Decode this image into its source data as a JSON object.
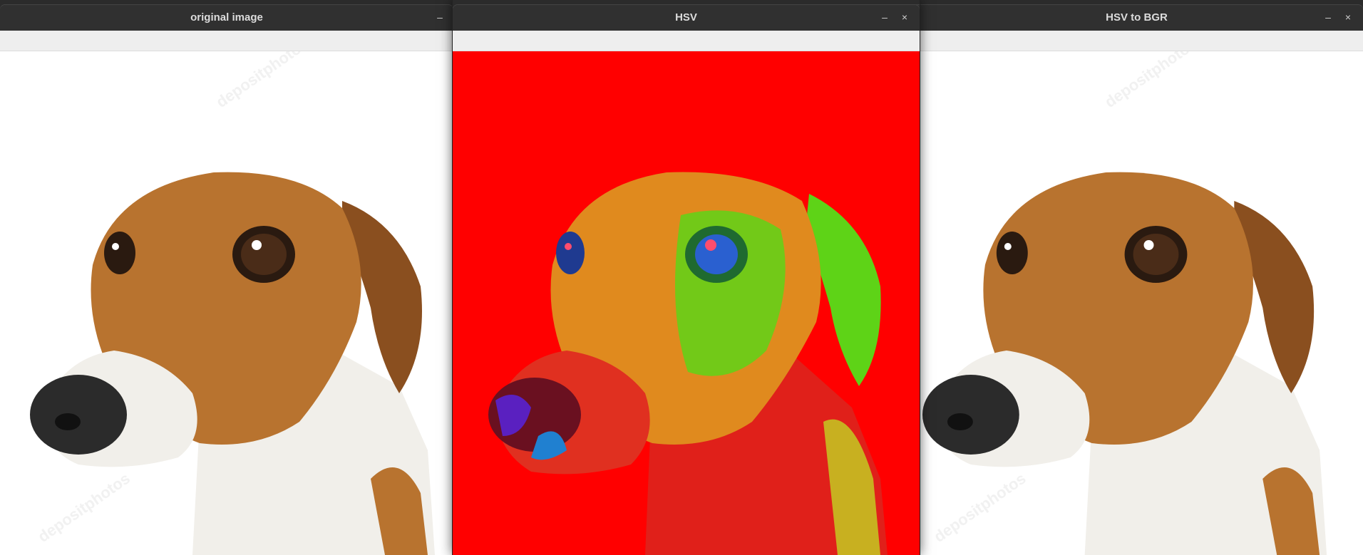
{
  "windows": [
    {
      "title": "original image",
      "minimize": "–"
    },
    {
      "title": "HSV",
      "minimize": "–",
      "close": "×"
    },
    {
      "title": "HSV to BGR",
      "minimize": "–",
      "close": "×"
    }
  ],
  "colors": {
    "hsv_background": "#ff0000",
    "original_background": "#ffffff",
    "dog_tan": "#b8732f",
    "dog_white": "#f1efea",
    "nose": "#2b2b2b",
    "hsv_face": "#e08a1e",
    "hsv_green": "#5ed317"
  },
  "watermark": "depositphotos"
}
